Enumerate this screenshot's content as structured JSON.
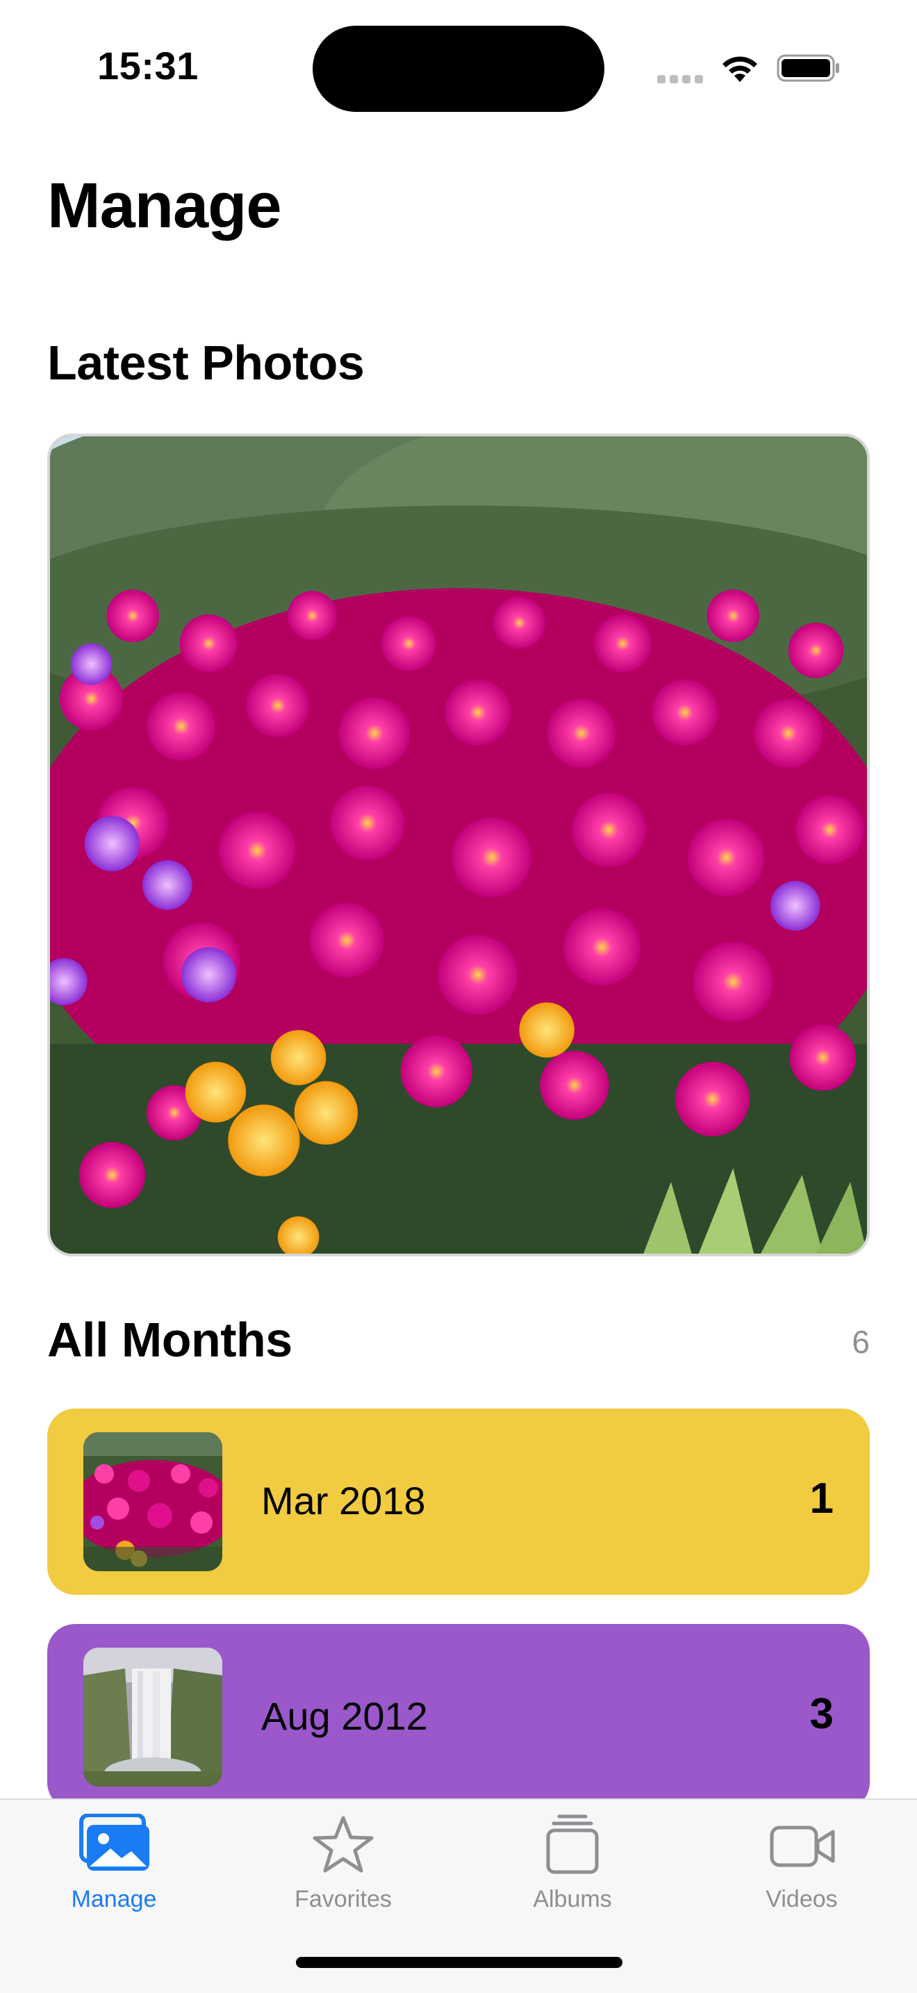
{
  "status_bar": {
    "time": "15:31",
    "icons": [
      "cellular-icon",
      "wifi-icon",
      "battery-icon"
    ]
  },
  "page": {
    "title": "Manage"
  },
  "latest": {
    "title": "Latest Photos"
  },
  "months": {
    "title": "All Months",
    "count": "6",
    "items": [
      {
        "label": "Mar 2018",
        "count": "1",
        "color": "#F1CB40"
      },
      {
        "label": "Aug 2012",
        "count": "3",
        "color": "#9A58CB"
      }
    ]
  },
  "tab_bar": {
    "accent": "#1A7CF5",
    "inactive": "#8E8E93",
    "tabs": [
      {
        "label": "Manage",
        "icon": "photos-icon",
        "active": true
      },
      {
        "label": "Favorites",
        "icon": "star-icon",
        "active": false
      },
      {
        "label": "Albums",
        "icon": "albums-stack-icon",
        "active": false
      },
      {
        "label": "Videos",
        "icon": "video-camera-icon",
        "active": false
      }
    ]
  }
}
